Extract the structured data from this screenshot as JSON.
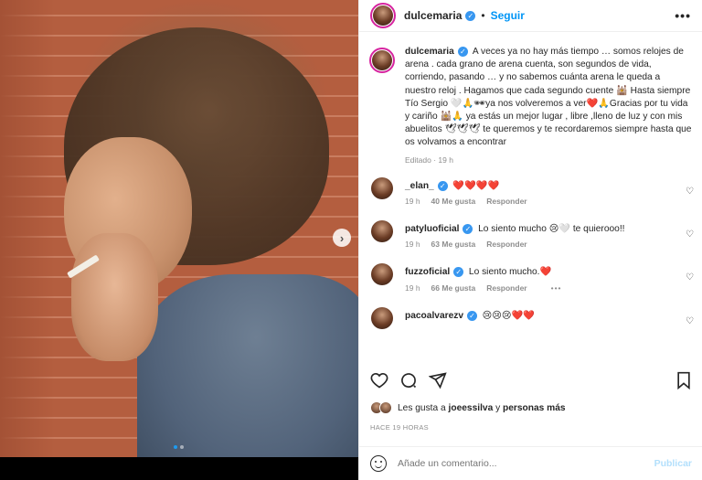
{
  "post": {
    "username": "dulcemaria",
    "follow_label": "Seguir",
    "caption": "A veces ya no hay más tiempo … somos relojes de arena . cada grano de arena cuenta, son segundos de vida, corriendo, pasando … y no sabemos cuánta arena le queda a nuestro reloj . Hagamos que cada segundo cuente 🕍 Hasta siempre Tío Sergio 🤍🙏🕶ya nos volveremos a ver❤️🙏Gracias por tu vida y cariño 🕍🙏 ya estás un mejor lugar , libre ,lleno de luz y con mis abuelitos 🕊🕊🕊 te queremos y te recordaremos siempre hasta que os volvamos a encontrar",
    "edited_label": "Editado",
    "edited_time": "19 h"
  },
  "comments": [
    {
      "user": "_elan_",
      "text": "❤️❤️❤️❤️",
      "time": "19 h",
      "likes": "40 Me gusta",
      "reply": "Responder"
    },
    {
      "user": "patyluoficial",
      "text": "Lo siento mucho 😢🤍 te quierooo!!",
      "time": "19 h",
      "likes": "63 Me gusta",
      "reply": "Responder"
    },
    {
      "user": "fuzzoficial",
      "text": "Lo siento mucho.❤️",
      "time": "19 h",
      "likes": "66 Me gusta",
      "reply": "Responder",
      "more": "•••"
    },
    {
      "user": "pacoalvarezv",
      "text": "😢😢😢❤️❤️"
    }
  ],
  "likes_summary": {
    "prefix": "Les gusta a",
    "user": "joeessilva",
    "conj": "y",
    "rest": "personas más"
  },
  "time_ago": "HACE 19 HORAS",
  "add_comment": {
    "placeholder": "Añade un comentario...",
    "publish": "Publicar"
  },
  "icons": [
    "more-icon",
    "heart-icon",
    "comment-icon",
    "share-icon",
    "save-icon",
    "emoji-icon",
    "next-arrow-icon",
    "verified-badge-icon"
  ],
  "colors": {
    "accent": "#0095f6",
    "like_red": "#e0245e",
    "verified": "#3897f0"
  }
}
